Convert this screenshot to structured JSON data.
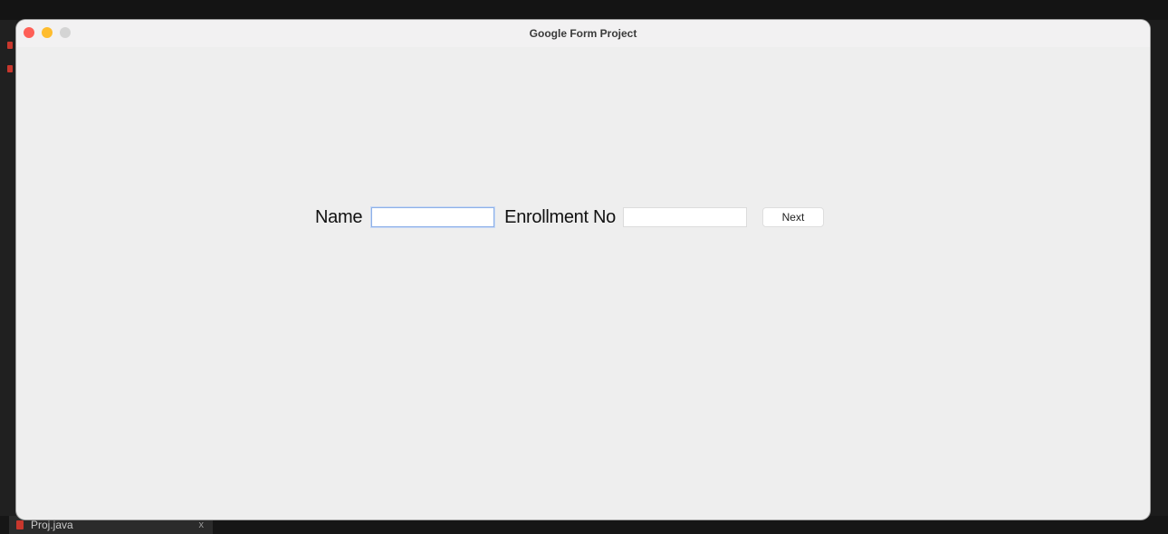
{
  "window": {
    "title": "Google Form Project"
  },
  "form": {
    "name_label": "Name",
    "name_value": "",
    "enrollment_label": "Enrollment No",
    "enrollment_value": "",
    "next_label": "Next"
  },
  "ide": {
    "file_tab": "Proj.java",
    "tab_count": "x"
  }
}
